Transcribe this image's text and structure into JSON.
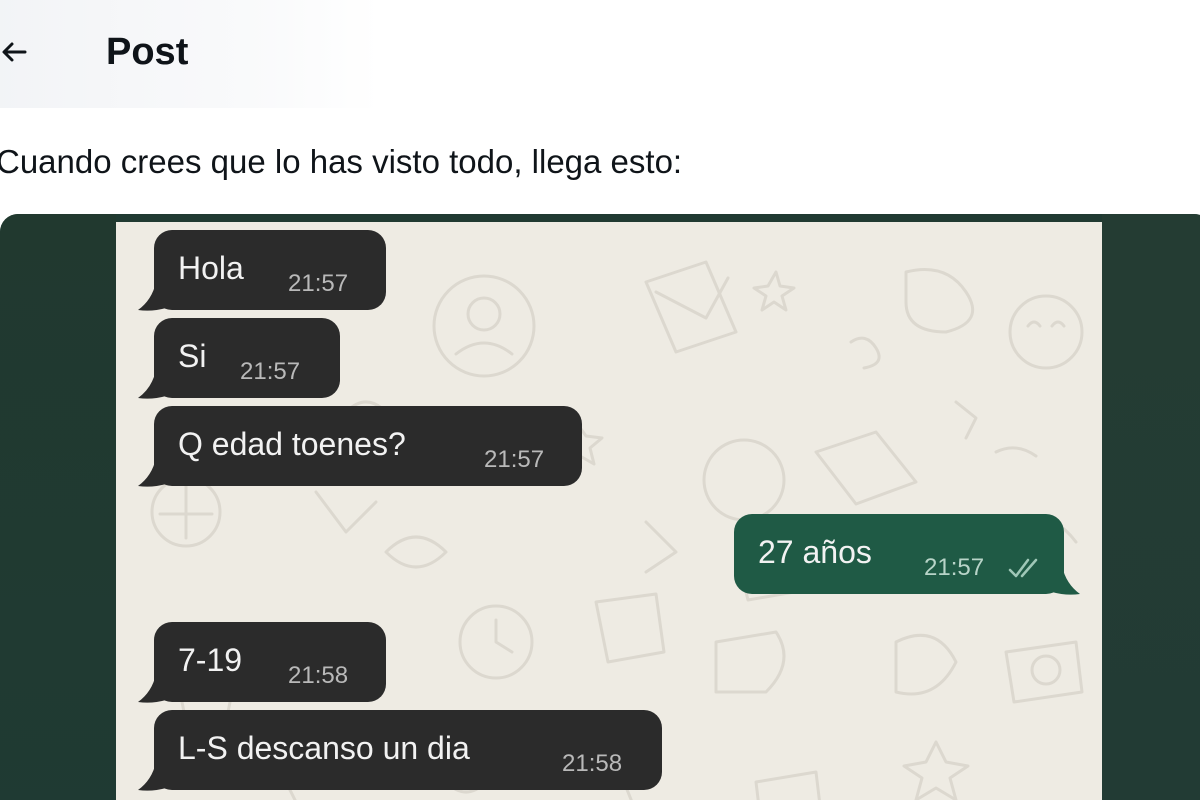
{
  "header": {
    "title": "Post",
    "back_icon": "arrow-left-icon"
  },
  "post": {
    "text": "Cuando crees que lo has visto todo, llega esto:"
  },
  "chat": {
    "messages": [
      {
        "direction": "in",
        "text": "Hola",
        "time": "21:57"
      },
      {
        "direction": "in",
        "text": "Si",
        "time": "21:57"
      },
      {
        "direction": "in",
        "text": "Q edad toenes?",
        "time": "21:57"
      },
      {
        "direction": "out",
        "text": "27 años",
        "time": "21:57",
        "status_icon": "double-check-icon"
      },
      {
        "direction": "in",
        "text": "7-19",
        "time": "21:58"
      },
      {
        "direction": "in",
        "text": "L-S descanso un dia",
        "time": "21:58"
      }
    ]
  },
  "colors": {
    "incoming_bubble": "#2b2b2b",
    "outgoing_bubble": "#1f5a45",
    "chat_background": "#eeebe3",
    "media_border": "#203a32"
  }
}
